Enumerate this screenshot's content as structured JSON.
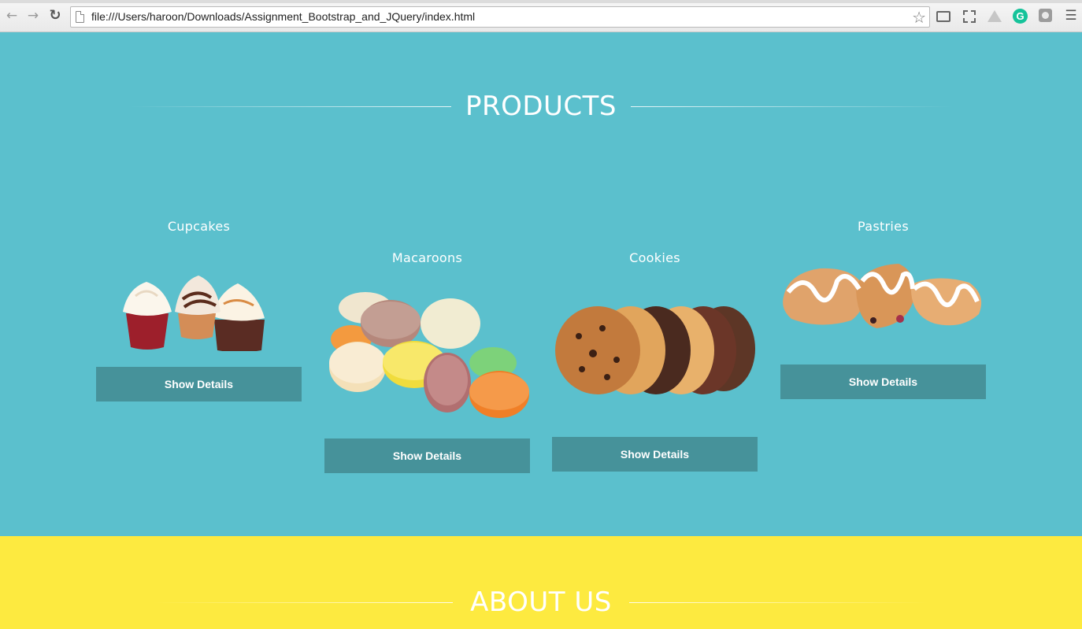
{
  "browser": {
    "url": "file:///Users/haroon/Downloads/Assignment_Bootstrap_and_JQuery/index.html",
    "icons": [
      "back-icon",
      "forward-icon",
      "reload-icon",
      "page-icon",
      "bookmark-star-icon",
      "cast-icon",
      "screenshot-icon",
      "drive-icon",
      "grammarly-icon",
      "extension-icon",
      "menu-icon"
    ],
    "grammarly_letter": "G"
  },
  "products": {
    "heading": "PRODUCTS",
    "items": [
      {
        "name": "Cupcakes",
        "button_label": "Show Details"
      },
      {
        "name": "Macaroons",
        "button_label": "Show Details"
      },
      {
        "name": "Cookies",
        "button_label": "Show Details"
      },
      {
        "name": "Pastries",
        "button_label": "Show Details"
      }
    ]
  },
  "about": {
    "heading": "ABOUT US"
  },
  "colors": {
    "products_bg": "#5bc0cd",
    "about_bg": "#fdea40",
    "button_bg": "#46929a"
  }
}
